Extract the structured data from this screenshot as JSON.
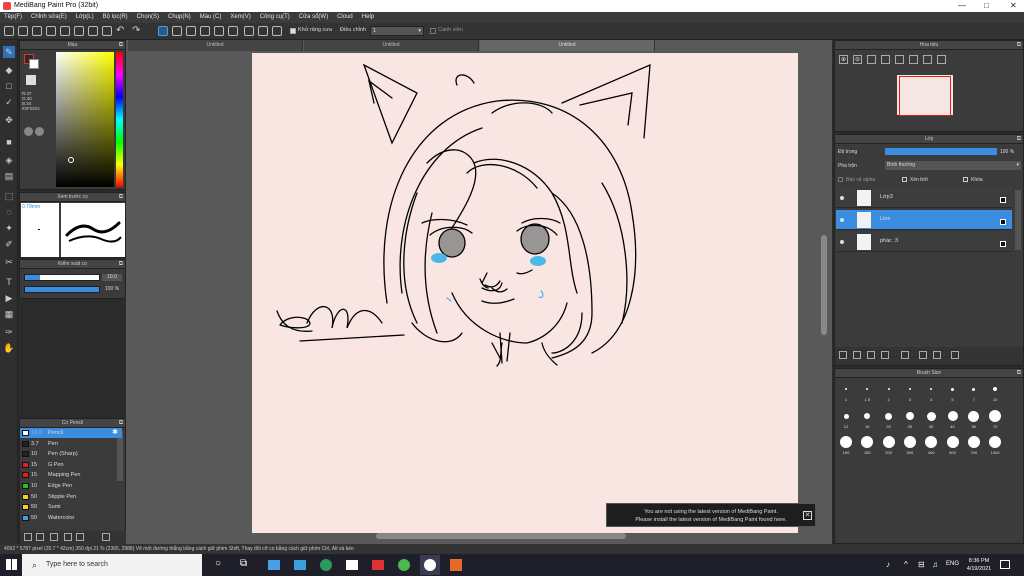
{
  "window": {
    "title": "MediBang Paint Pro (32bit)",
    "minimize": "—",
    "maximize": "□",
    "close": "✕"
  },
  "menu": [
    "Tệp(F)",
    "Chỉnh sửa(E)",
    "Lớp(L)",
    "Bộ lọc(R)",
    "Chọn(S)",
    "Chụp(N)",
    "Màu (C)",
    "Xem(V)",
    "Công cụ(T)",
    "Cửa sổ(W)",
    "Cloud",
    "Help"
  ],
  "toolbar": {
    "anti_alias": "Khử răng cưa",
    "adjust_label": "Điều chỉnh",
    "adjust_value": "1",
    "correction": "Canh viền"
  },
  "tabs": [
    "Untitled",
    "Untitled",
    "Untitled"
  ],
  "color_panel": {
    "title": "Màu",
    "r": "R:47",
    "g": "G:40",
    "b": "B:34",
    "hex": "#2F2822"
  },
  "brush_preview": {
    "title": "Xem trước cọ",
    "size": "0.79mm"
  },
  "brush_control": {
    "title": "Kiểm soát cọ",
    "size": "10.0",
    "opacity": "100 %"
  },
  "brush_list": {
    "title": "Cọ Pencil",
    "items": [
      {
        "size": "10.0",
        "name": "Pencil",
        "color": "#ffffff",
        "active": true
      },
      {
        "size": "3.7",
        "name": "Pen",
        "color": "#222222"
      },
      {
        "size": "10",
        "name": "Pen (Sharp)",
        "color": "#222222"
      },
      {
        "size": "15",
        "name": "G Pen",
        "color": "#e02020"
      },
      {
        "size": "15",
        "name": "Mapping Pen",
        "color": "#e02020"
      },
      {
        "size": "10",
        "name": "Edge Pen",
        "color": "#20c020"
      },
      {
        "size": "50",
        "name": "Stipple Pen",
        "color": "#f0d020"
      },
      {
        "size": "50",
        "name": "Sumi",
        "color": "#f0d020"
      },
      {
        "size": "50",
        "name": "Watercolor",
        "color": "#40a0e0"
      }
    ]
  },
  "navigator": {
    "title": "Hoa tiêu"
  },
  "layer_panel": {
    "title": "Lớp",
    "opacity_label": "Độ trong",
    "opacity_value": "100 %",
    "blend_label": "Pha trộn",
    "blend_value": "Bình thường",
    "protect_alpha": "Bảo vệ alpha",
    "clipping": "Xén bớt",
    "lock": "Khóa",
    "layers": [
      {
        "name": "Lớp3",
        "selected": false
      },
      {
        "name": "Line",
        "selected": true
      },
      {
        "name": "phác :3",
        "selected": false
      }
    ]
  },
  "brush_size": {
    "title": "Brush Size",
    "rows": [
      [
        "1",
        "1.5",
        "2",
        "3",
        "4",
        "5",
        "7",
        "10"
      ],
      [
        "12",
        "15",
        "20",
        "25",
        "30",
        "40",
        "50",
        "70"
      ],
      [
        "100",
        "150",
        "200",
        "300",
        "400",
        "500",
        "700",
        "1000"
      ]
    ]
  },
  "notification": {
    "line1": "You are not using the latest version of MediBang Paint.",
    "line2": "Please install the latest version of MediBang Paint found here."
  },
  "statusbar": "4092 * 5787 pixel  (20.7 * 42cm)  350 dpi  21 %  (2365, 2988)  Vẽ một đường thẳng bằng cách giữ phím Shift, Thay đổi cỡ cọ bằng cách giữ phím Ctrl, Alt và kéo",
  "taskbar": {
    "search": "Type here to search",
    "time": "8:36 PM",
    "date": "4/19/2021",
    "lang": "ENG"
  }
}
